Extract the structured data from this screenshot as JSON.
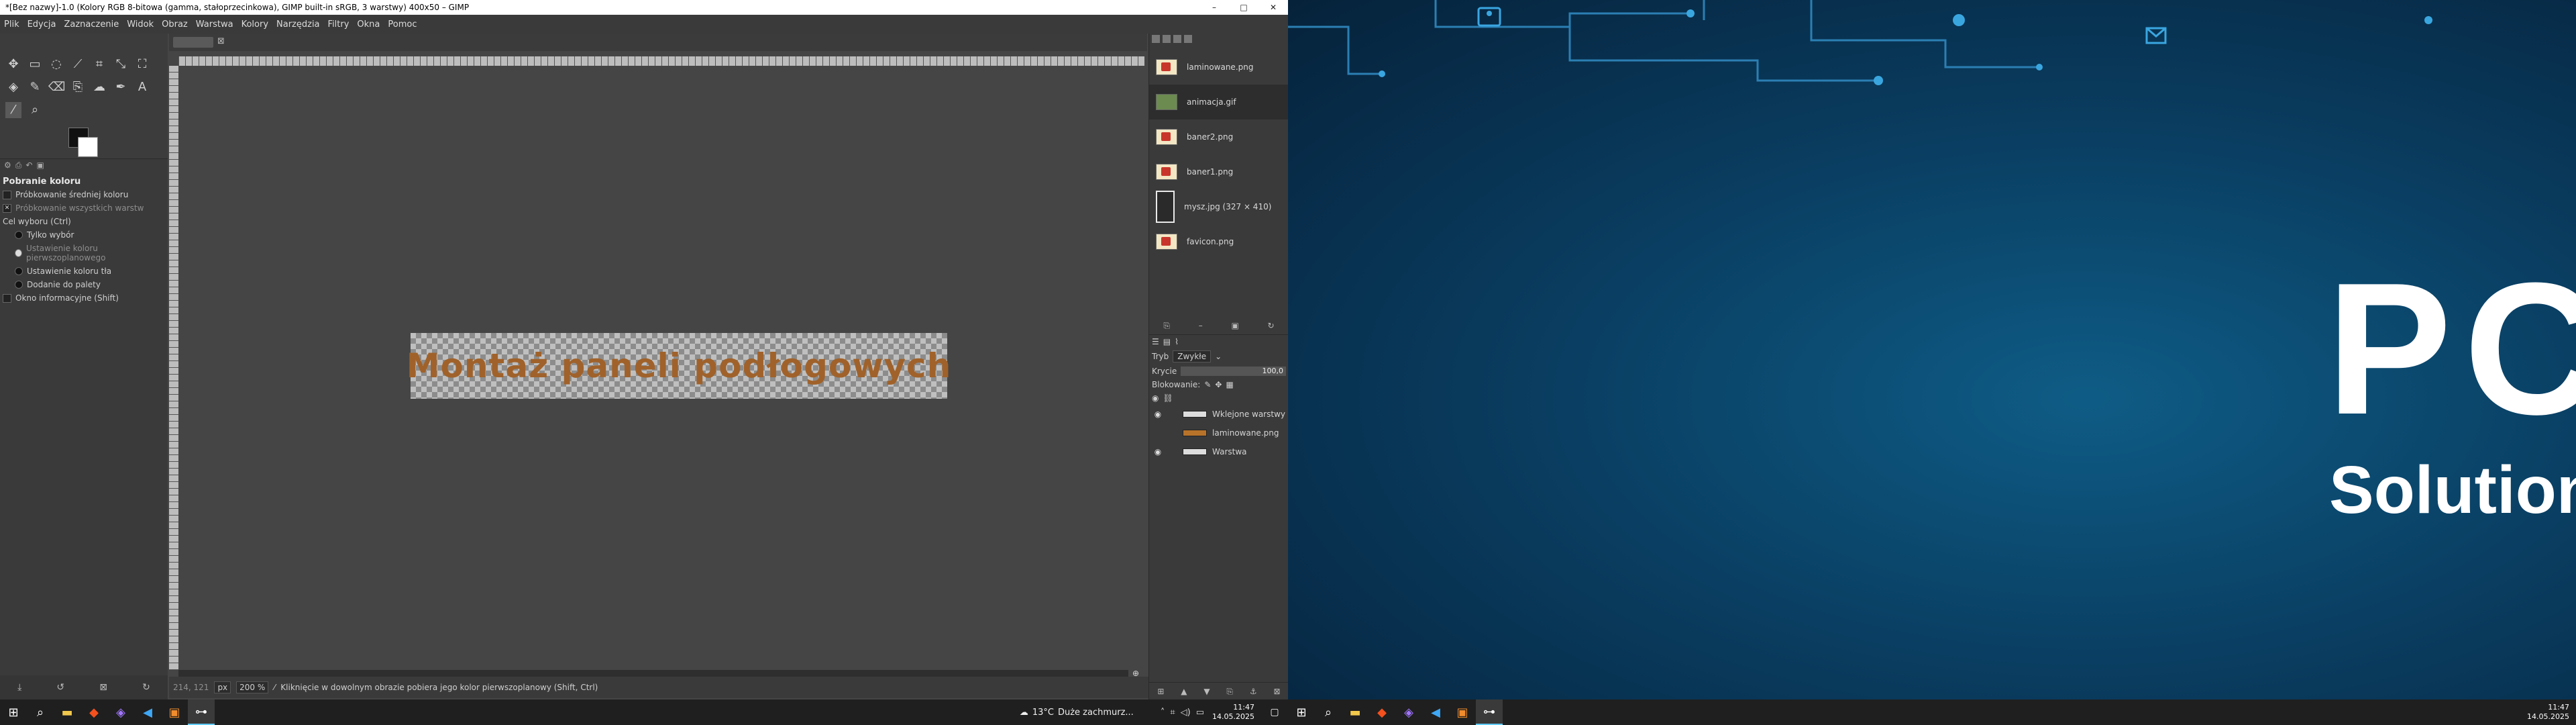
{
  "window": {
    "title": "*[Bez nazwy]-1.0 (Kolory RGB 8-bitowa (gamma, stałoprzecinkowa), GIMP built-in sRGB, 3 warstwy) 400x50 – GIMP",
    "min": "–",
    "max": "□",
    "close": "✕"
  },
  "menu": [
    "Plik",
    "Edycja",
    "Zaznaczenie",
    "Widok",
    "Obraz",
    "Warstwa",
    "Kolory",
    "Narzędzia",
    "Filtry",
    "Okna",
    "Pomoc"
  ],
  "tool_options": {
    "title": "Pobranie koloru",
    "sample_average": "Próbkowanie średniej koloru",
    "sample_merged": "Próbkowanie wszystkich warstw",
    "target_label": "Cel wyboru (Ctrl)",
    "target_pick_only": "Tylko wybór",
    "target_set_fg": "Ustawienie koloru pierwszoplanowego",
    "target_set_bg": "Ustawienie koloru tła",
    "target_add_palette": "Dodanie do palety",
    "info_window": "Okno informacyjne (Shift)"
  },
  "canvas": {
    "tab_close": "⊠",
    "image_text": "Montaż paneli podłogowych",
    "nav": "⊕"
  },
  "status": {
    "coords": "214, 121",
    "unit": "px",
    "zoom": "200 %",
    "message": "Kliknięcie w dowolnym obrazie pobiera jego kolor pierwszoplanowy (Shift, Ctrl)"
  },
  "images": [
    {
      "name": "laminowane.png",
      "thumb": "red"
    },
    {
      "name": "animacja.gif",
      "thumb": "gif"
    },
    {
      "name": "baner2.png",
      "thumb": "red"
    },
    {
      "name": "baner1.png",
      "thumb": "red"
    },
    {
      "name": "mysz.jpg (327 × 410)",
      "thumb": "dark"
    },
    {
      "name": "favicon.png",
      "thumb": "red"
    }
  ],
  "layers_panel": {
    "mode_label": "Tryb",
    "mode_value": "Zwykłe",
    "opacity_label": "Krycie",
    "opacity_value": "100,0",
    "lock_label": "Blokowanie:",
    "layers": [
      {
        "name": "Wklejone warstwy",
        "visible": true,
        "thumb": "white"
      },
      {
        "name": "laminowane.png",
        "visible": false,
        "thumb": "orange"
      },
      {
        "name": "Warstwa",
        "visible": true,
        "thumb": "white"
      }
    ]
  },
  "taskbar": {
    "weather_temp": "13°C",
    "weather_text": "Duże zachmurz...",
    "time": "11:47",
    "date": "14.05.2025"
  },
  "wallpaper": {
    "line1": "PC",
    "line2": "Solution"
  }
}
